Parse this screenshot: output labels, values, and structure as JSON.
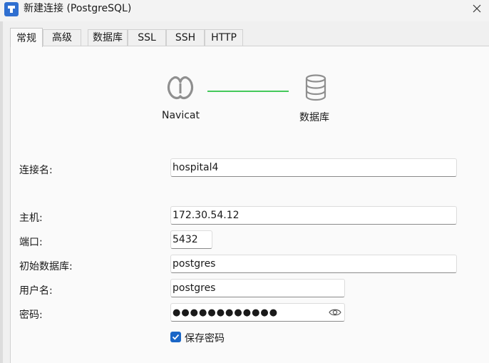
{
  "window": {
    "title": "新建连接 (PostgreSQL)",
    "app_icon": "navicat-connection-icon",
    "close_icon": "close-icon"
  },
  "tabs": [
    {
      "label": "常规",
      "active": true
    },
    {
      "label": "高级",
      "active": false
    },
    {
      "label": "数据库",
      "active": false
    },
    {
      "label": "SSL",
      "active": false
    },
    {
      "label": "SSH",
      "active": false
    },
    {
      "label": "HTTP",
      "active": false
    }
  ],
  "diagram": {
    "source_label": "Navicat",
    "target_label": "数据库",
    "line_color": "#44c95b"
  },
  "form": {
    "connection_name": {
      "label": "连接名:",
      "value": "hospital4"
    },
    "host": {
      "label": "主机:",
      "value": "172.30.54.12"
    },
    "port": {
      "label": "端口:",
      "value": "5432"
    },
    "initial_database": {
      "label": "初始数据库:",
      "value": "postgres"
    },
    "username": {
      "label": "用户名:",
      "value": "postgres"
    },
    "password": {
      "label": "密码:",
      "masked_value": "●●●●●●●●●●●●"
    },
    "save_password": {
      "label": "保存密码",
      "checked": true
    }
  },
  "colors": {
    "accent": "#1a66c6",
    "connector_line": "#44c95b"
  }
}
